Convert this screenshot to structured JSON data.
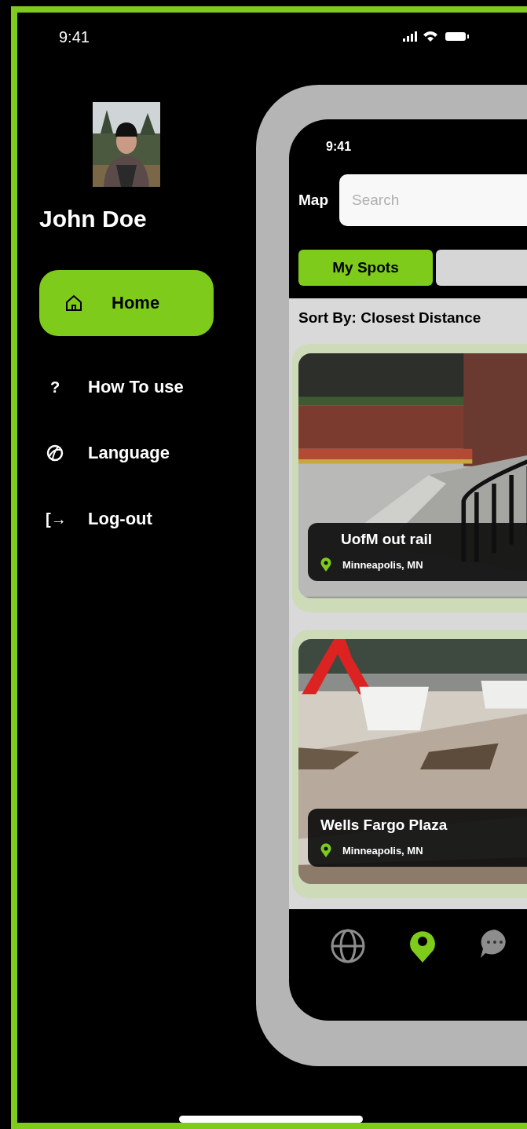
{
  "status_bar": {
    "time": "9:41"
  },
  "profile": {
    "name": "John Doe"
  },
  "menu": [
    {
      "label": "Home",
      "kind": "home",
      "selected": true
    },
    {
      "label": "How To use",
      "kind": "glyph",
      "icon": "?",
      "selected": false
    },
    {
      "label": "Language",
      "kind": "globe",
      "selected": false
    },
    {
      "label": "Log-out",
      "kind": "glyph",
      "icon": "[→",
      "selected": false
    }
  ],
  "phone": {
    "status_time": "9:41",
    "title": "Map",
    "search": {
      "placeholder": "Search"
    },
    "tabs": [
      {
        "label": "My Spots",
        "selected": true
      },
      {
        "selected": false
      }
    ],
    "sort_label": "Sort By: Closest Distance",
    "spots": [
      {
        "name": "UofM out rail",
        "location": "Minneapolis, MN"
      },
      {
        "name": "Wells Fargo Plaza",
        "location": "Minneapolis, MN"
      }
    ],
    "nav": [
      {
        "kind": "globe",
        "selected": false
      },
      {
        "kind": "pin",
        "selected": true
      },
      {
        "kind": "chat",
        "selected": false
      }
    ]
  }
}
